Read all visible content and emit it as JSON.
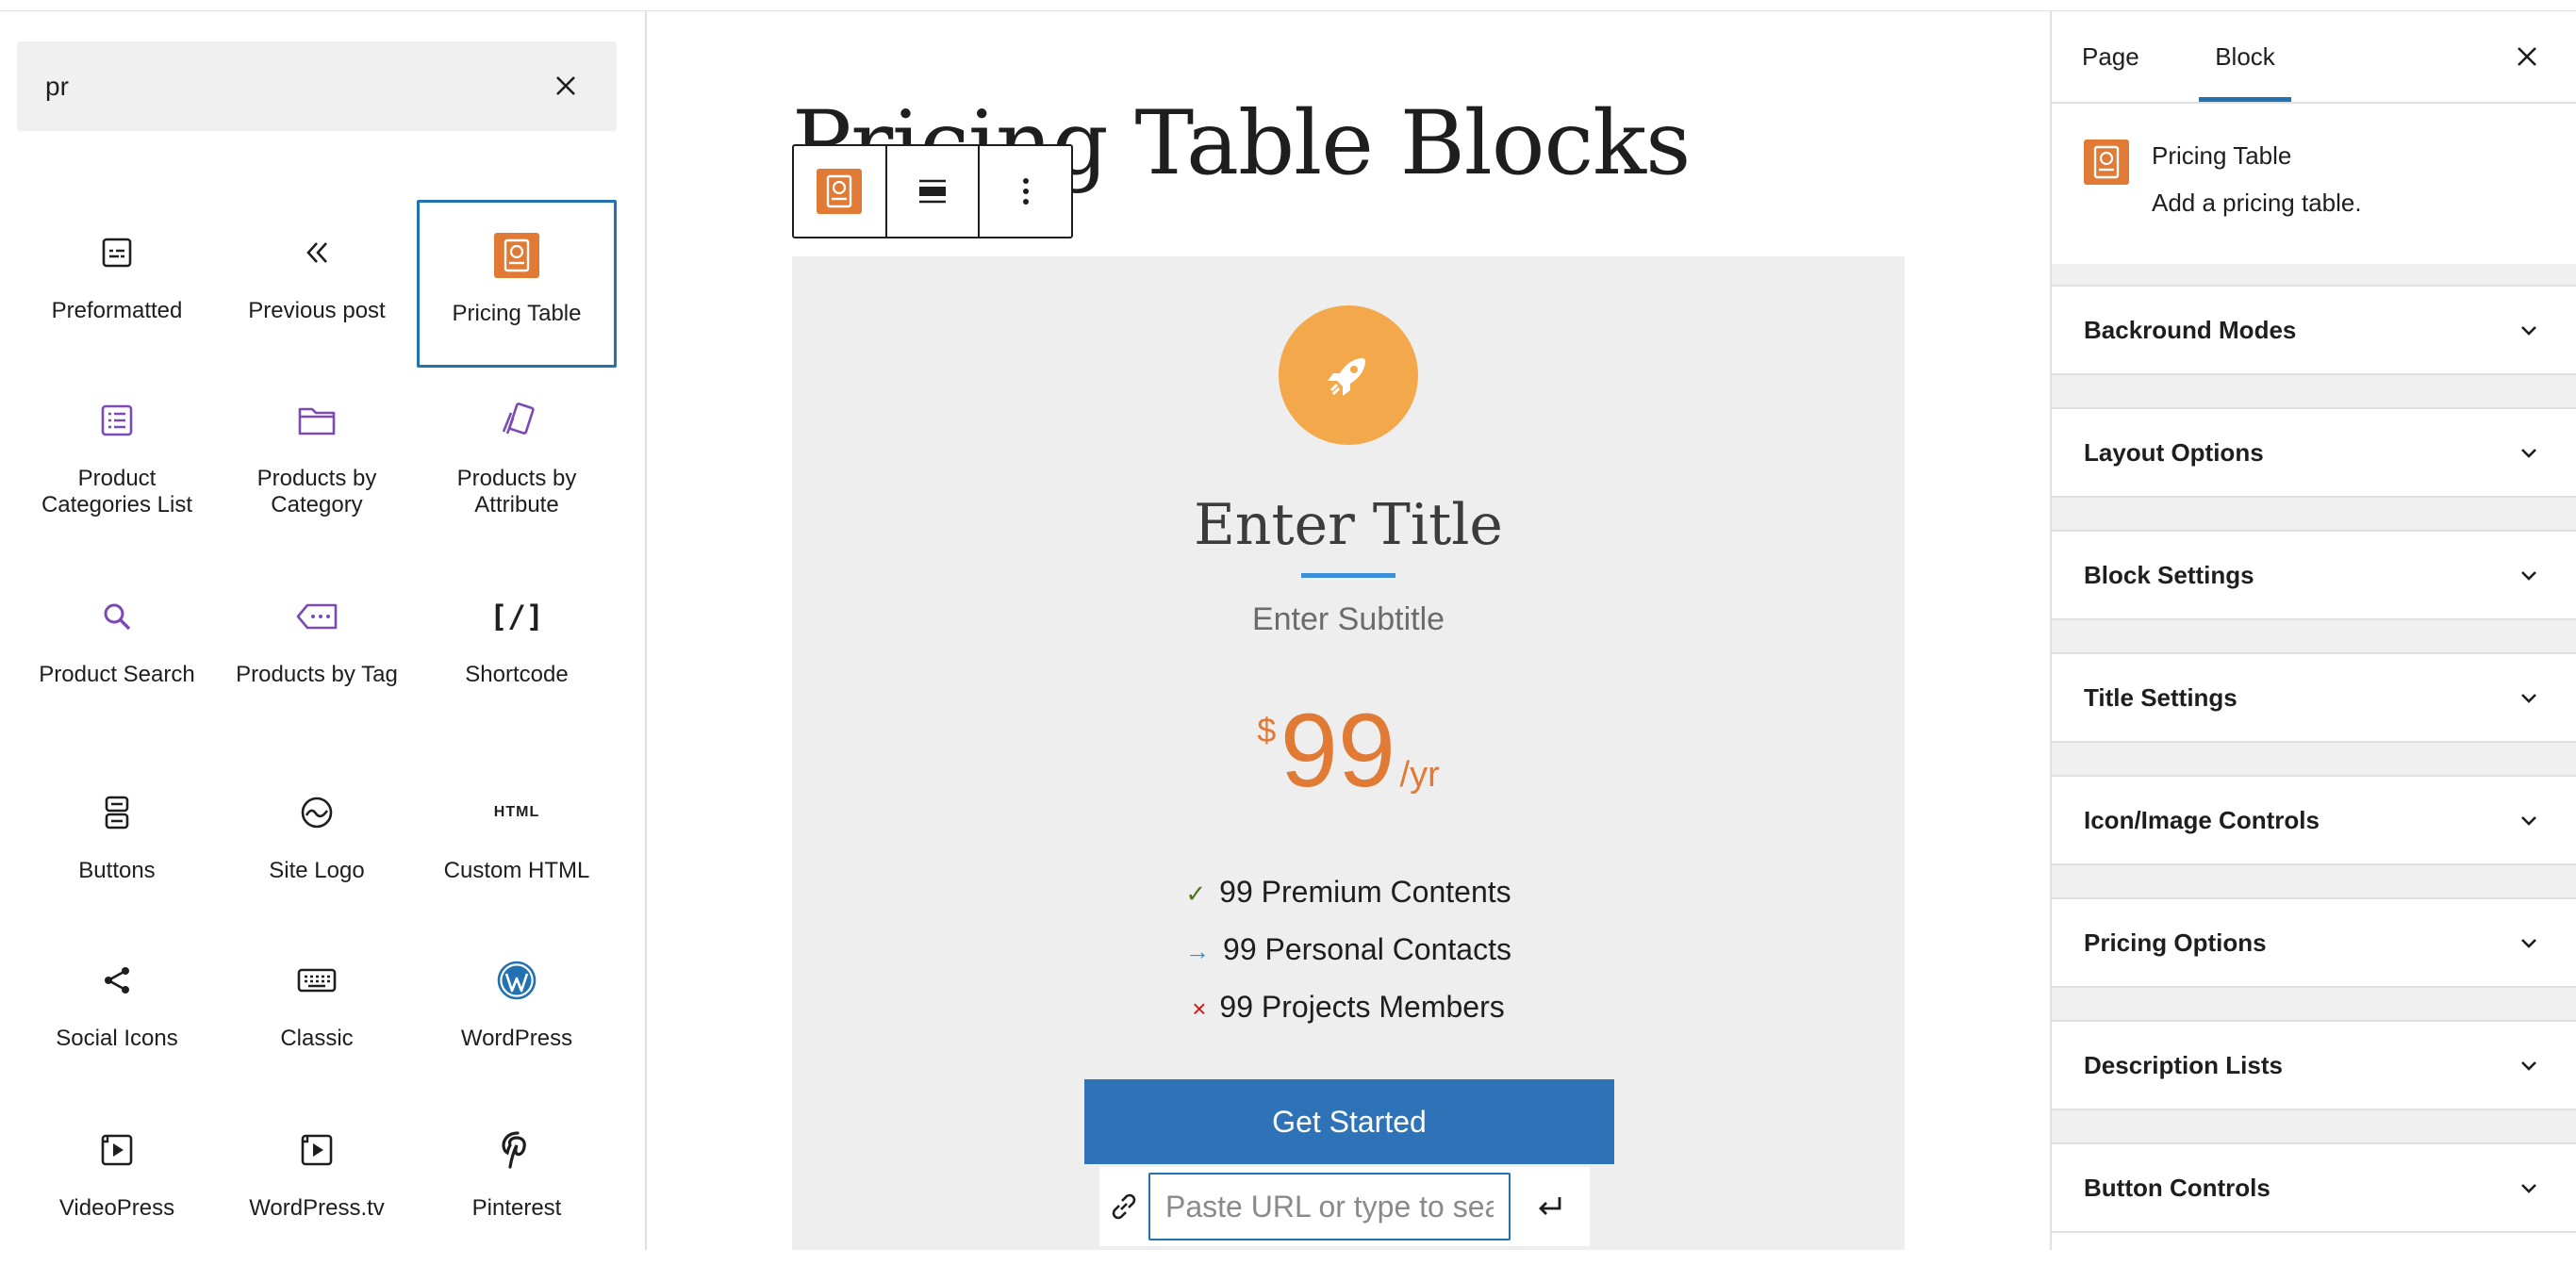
{
  "inserter": {
    "search_value": "pr",
    "blocks": [
      {
        "label": "Preformatted",
        "icon": "preformatted-icon"
      },
      {
        "label": "Previous post",
        "icon": "previous-post-icon"
      },
      {
        "label": "Pricing Table",
        "icon": "pricing-table-icon",
        "selected": true
      },
      {
        "label": "Product Categories List",
        "icon": "product-categories-list-icon"
      },
      {
        "label": "Products by Category",
        "icon": "folder-icon"
      },
      {
        "label": "Products by Attribute",
        "icon": "products-by-attribute-icon"
      },
      {
        "label": "Product Search",
        "icon": "search-icon"
      },
      {
        "label": "Products by Tag",
        "icon": "tag-icon"
      },
      {
        "label": "Shortcode",
        "icon": "shortcode-icon"
      },
      {
        "label": "Buttons",
        "icon": "buttons-icon"
      },
      {
        "label": "Site Logo",
        "icon": "site-logo-icon"
      },
      {
        "label": "Custom HTML",
        "icon": "html-icon"
      },
      {
        "label": "Social Icons",
        "icon": "share-icon"
      },
      {
        "label": "Classic",
        "icon": "keyboard-icon"
      },
      {
        "label": "WordPress",
        "icon": "wordpress-icon"
      },
      {
        "label": "VideoPress",
        "icon": "videopress-icon"
      },
      {
        "label": "WordPress.tv",
        "icon": "wordpress-tv-icon"
      },
      {
        "label": "Pinterest",
        "icon": "pinterest-icon"
      }
    ],
    "html_glyph": "HTML",
    "shortcode_glyph": "[/]"
  },
  "canvas": {
    "page_title": "Pricing Table Blocks",
    "card": {
      "title": "Enter Title",
      "subtitle": "Enter Subtitle",
      "currency": "$",
      "price": "99",
      "period": "/yr",
      "features": [
        {
          "text": "99 Premium Contents",
          "mark": "✓",
          "mark_color": "#4a7a1a"
        },
        {
          "text": "99 Personal Contacts",
          "mark": "→",
          "mark_color": "#2e8fd0"
        },
        {
          "text": "99 Projects Members",
          "mark": "×",
          "mark_color": "#cc1818"
        }
      ],
      "button_label": "Get Started",
      "url_placeholder": "Paste URL or type to search",
      "accent_color": "#e07a34",
      "button_color": "#2e73b8"
    }
  },
  "sidebar": {
    "tabs": [
      "Page",
      "Block"
    ],
    "active_tab": "Block",
    "block_name": "Pricing Table",
    "block_description": "Add a pricing table.",
    "panels": [
      "Backround Modes",
      "Layout Options",
      "Block Settings",
      "Title Settings",
      "Icon/Image Controls",
      "Pricing Options",
      "Description Lists",
      "Button Controls"
    ]
  }
}
